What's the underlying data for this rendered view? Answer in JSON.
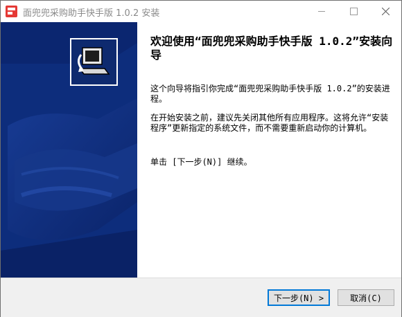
{
  "window": {
    "title": "面兜兜采购助手快手版 1.0.2 安装"
  },
  "content": {
    "heading": "欢迎使用“面兜兜采购助手快手版 1.0.2”安装向导",
    "paragraph1": "这个向导将指引你完成“面兜兜采购助手快手版 1.0.2”的安装进程。",
    "paragraph2": "在开始安装之前，建议先关闭其他所有应用程序。这将允许“安装程序”更新指定的系统文件，而不需要重新启动你的计算机。",
    "paragraph3": "单击 [下一步(N)] 继续。"
  },
  "buttons": {
    "next": "下一步(N) >",
    "cancel": "取消(C)"
  },
  "colors": {
    "sidebar": "#0d2d7c",
    "accent": "#0078d7"
  },
  "icons": {
    "app": "app-icon",
    "installer": "installer-computer-icon",
    "minimize": "minimize-icon",
    "maximize": "maximize-icon",
    "close": "close-icon"
  }
}
